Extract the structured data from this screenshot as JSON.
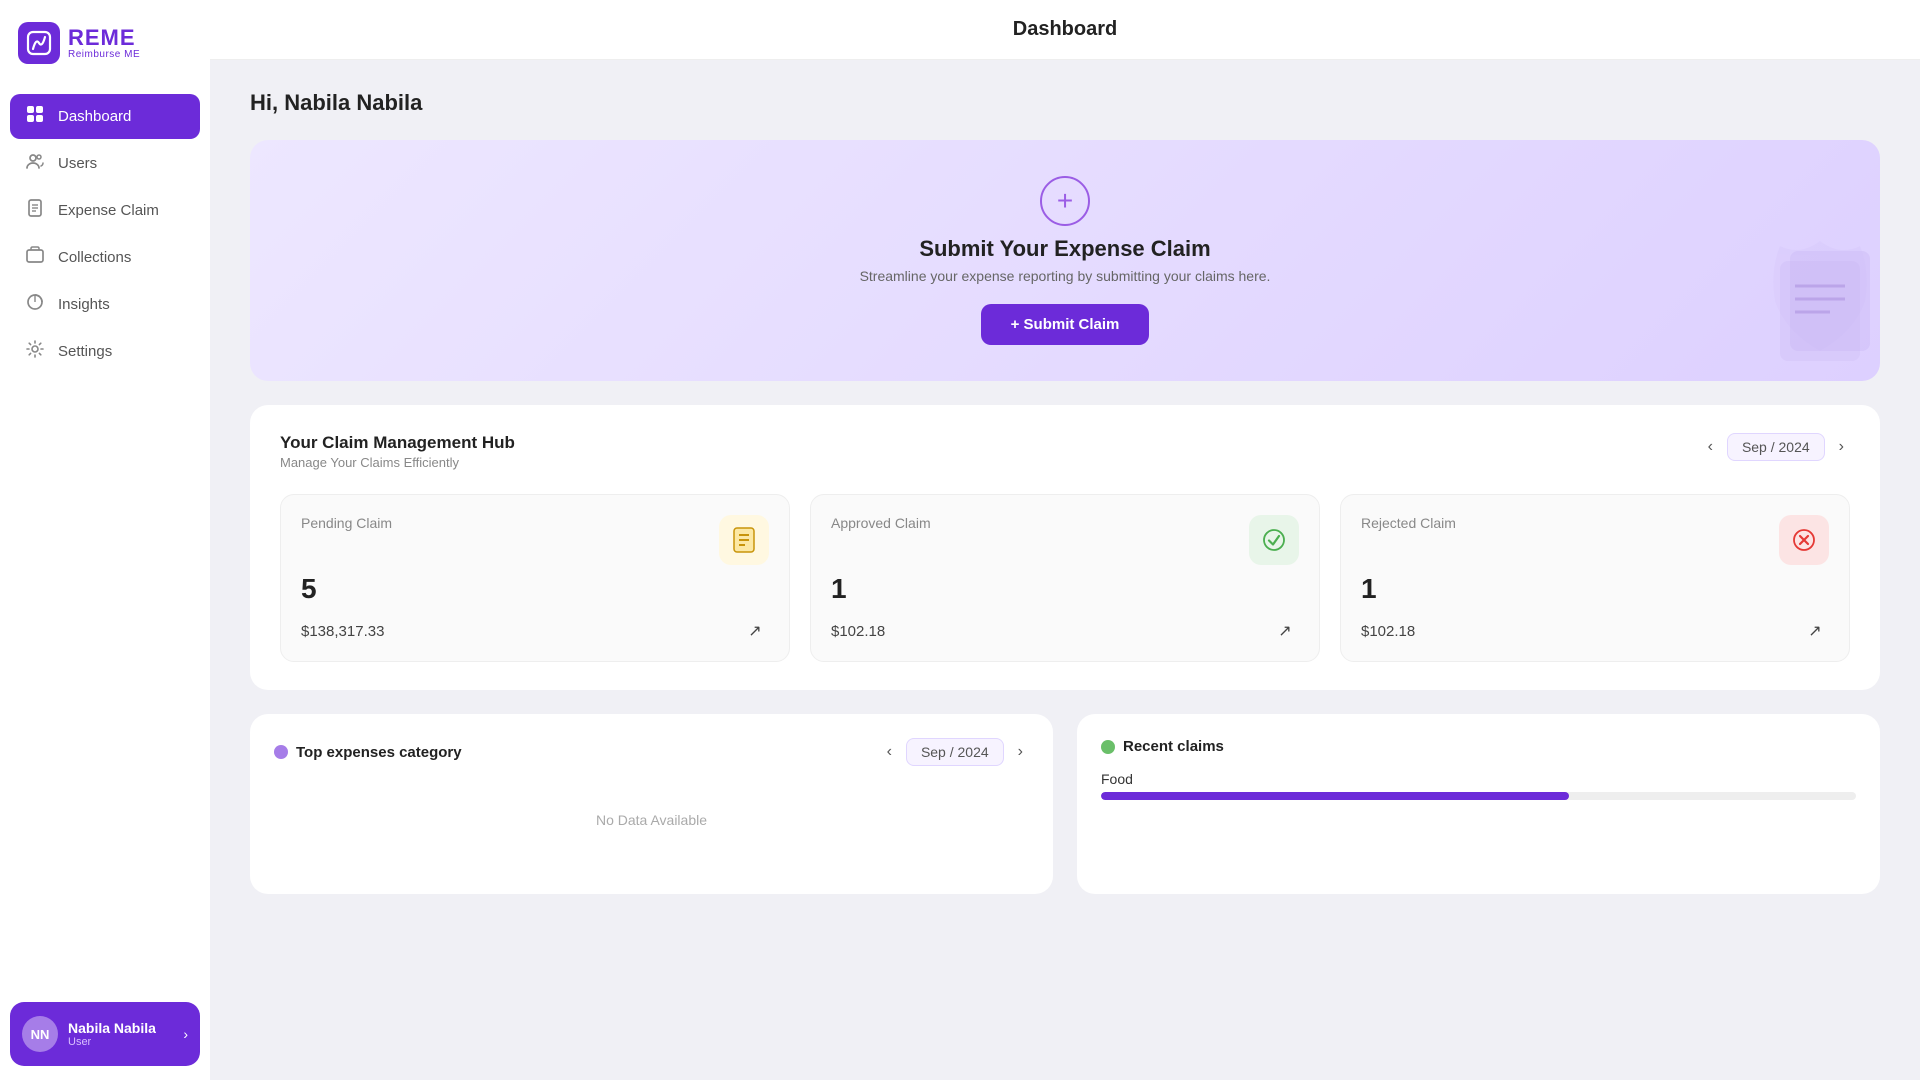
{
  "app": {
    "logo_title": "REME",
    "logo_sub": "Reimburse ME"
  },
  "sidebar": {
    "nav_items": [
      {
        "key": "dashboard",
        "label": "Dashboard",
        "icon": "⊞",
        "active": true
      },
      {
        "key": "users",
        "label": "Users",
        "icon": "👥",
        "active": false
      },
      {
        "key": "expense-claim",
        "label": "Expense Claim",
        "icon": "⚙",
        "active": false
      },
      {
        "key": "collections",
        "label": "Collections",
        "icon": "📋",
        "active": false
      },
      {
        "key": "insights",
        "label": "Insights",
        "icon": "◑",
        "active": false
      },
      {
        "key": "settings",
        "label": "Settings",
        "icon": "⚙",
        "active": false
      }
    ],
    "user": {
      "initials": "NN",
      "name": "Nabila Nabila",
      "role": "User"
    }
  },
  "topbar": {
    "title": "Dashboard"
  },
  "greeting": "Hi,  Nabila Nabila",
  "banner": {
    "title": "Submit Your Expense Claim",
    "subtitle": "Streamline your expense reporting by submitting your claims here.",
    "button_label": "+ Submit Claim"
  },
  "claim_hub": {
    "title": "Your Claim Management Hub",
    "subtitle": "Manage Your Claims Efficiently",
    "month": "Sep / 2024",
    "cards": [
      {
        "label": "Pending Claim",
        "count": "5",
        "amount": "$138,317.33",
        "icon": "⏳",
        "icon_class": "icon-yellow"
      },
      {
        "label": "Approved Claim",
        "count": "1",
        "amount": "$102.18",
        "icon": "✅",
        "icon_class": "icon-green"
      },
      {
        "label": "Rejected Claim",
        "count": "1",
        "amount": "$102.18",
        "icon": "🚫",
        "icon_class": "icon-red"
      }
    ]
  },
  "top_expenses": {
    "title": "Top expenses category",
    "month": "Sep / 2024",
    "no_data": "No Data Available"
  },
  "recent_claims": {
    "title": "Recent claims",
    "items": [
      {
        "label": "Food",
        "fill_pct": 62
      }
    ]
  }
}
